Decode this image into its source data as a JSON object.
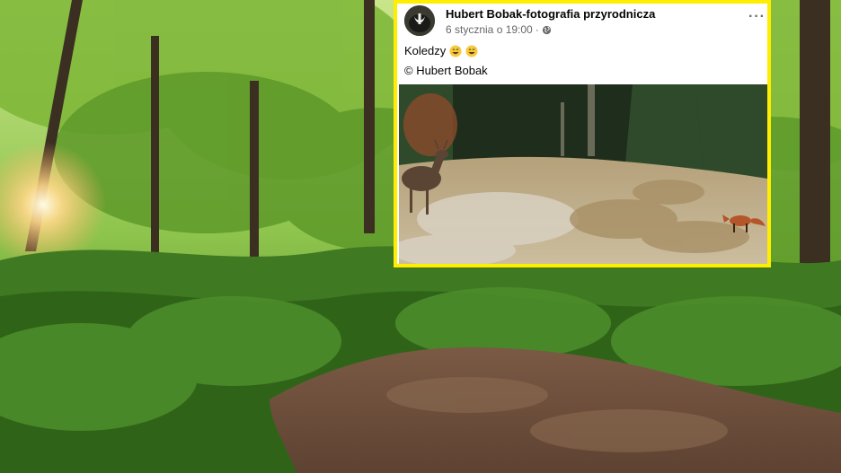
{
  "post": {
    "author": "Hubert Bobak-fotografia przyrodnicza",
    "timestamp": "6 stycznia o 19:00",
    "separator": "·",
    "audience_icon": "globe-icon",
    "more_icon": "more-options-icon",
    "more_label": "···",
    "caption": "Koledzy",
    "caption_emojis": [
      "grinning-sweat-emoji",
      "grinning-sweat-emoji"
    ],
    "credit": "© Hubert Bobak"
  },
  "colors": {
    "frame_border": "#ffee00",
    "author_text": "#050505",
    "meta_text": "#65676b"
  }
}
